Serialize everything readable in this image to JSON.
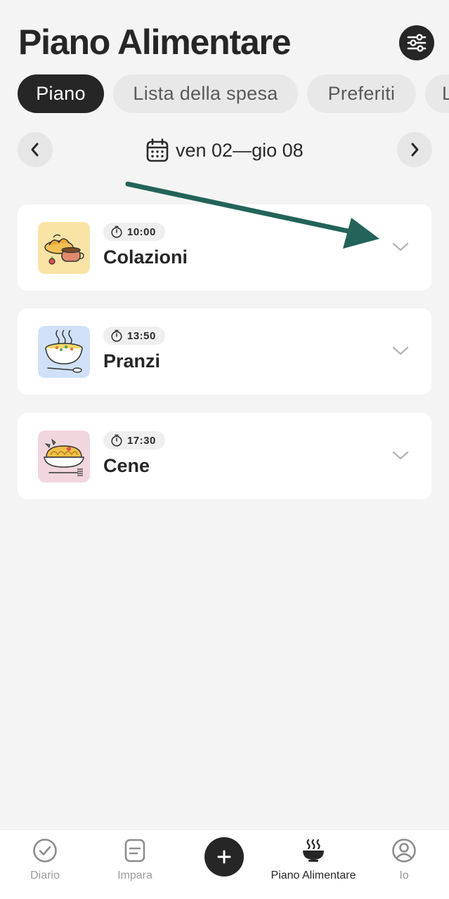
{
  "header": {
    "title": "Piano Alimentare",
    "filter_icon": "sliders-icon"
  },
  "tabs": [
    {
      "label": "Piano",
      "active": true
    },
    {
      "label": "Lista della spesa",
      "active": false
    },
    {
      "label": "Preferiti",
      "active": false
    },
    {
      "label": "L",
      "active": false
    }
  ],
  "week": {
    "range": "ven 02—gio 08",
    "prev_icon": "chevron-left-icon",
    "next_icon": "chevron-right-icon",
    "calendar_icon": "calendar-icon"
  },
  "meals": [
    {
      "time": "10:00",
      "name": "Colazioni",
      "image": "breakfast-illustration",
      "bg": "#f9e4a6"
    },
    {
      "time": "13:50",
      "name": "Pranzi",
      "image": "soup-bowl-illustration",
      "bg": "#cfe0f7"
    },
    {
      "time": "17:30",
      "name": "Cene",
      "image": "pasta-dish-illustration",
      "bg": "#f2d6de"
    }
  ],
  "annotation": {
    "color": "#236359"
  },
  "bottom_nav": [
    {
      "label": "Diario",
      "icon": "check-circle-icon",
      "active": false
    },
    {
      "label": "Impara",
      "icon": "note-icon",
      "active": false
    },
    {
      "label": "",
      "icon": "plus-icon",
      "active": false
    },
    {
      "label": "Piano Alimentare",
      "icon": "steaming-bowl-icon",
      "active": true
    },
    {
      "label": "Io",
      "icon": "user-circle-icon",
      "active": false
    }
  ]
}
